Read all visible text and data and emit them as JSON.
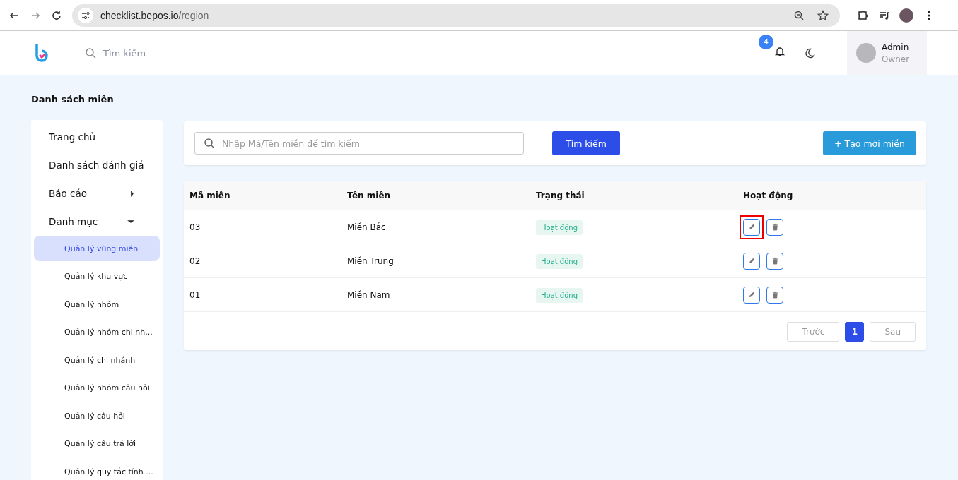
{
  "browser": {
    "url_host": "checklist.bepos.io",
    "url_path": "/region"
  },
  "header": {
    "search_placeholder": "Tìm kiếm",
    "notification_count": "4",
    "user": {
      "name": "Admin",
      "role": "Owner"
    }
  },
  "page_title": "Danh sách miền",
  "sidebar": {
    "items": [
      {
        "label": "Trang chủ",
        "kind": "link"
      },
      {
        "label": "Danh sách đánh giá",
        "kind": "link"
      },
      {
        "label": "Báo cáo",
        "kind": "group",
        "expanded": false
      },
      {
        "label": "Danh mục",
        "kind": "group",
        "expanded": true,
        "children": [
          {
            "label": "Quản lý vùng miền",
            "selected": true
          },
          {
            "label": "Quản lý khu vực",
            "selected": false
          },
          {
            "label": "Quản lý nhóm",
            "selected": false
          },
          {
            "label": "Quản lý nhóm chi nh...",
            "selected": false
          },
          {
            "label": "Quản lý chi nhánh",
            "selected": false
          },
          {
            "label": "Quản lý nhóm câu hỏi",
            "selected": false
          },
          {
            "label": "Quản lý câu hỏi",
            "selected": false
          },
          {
            "label": "Quản lý câu trả lời",
            "selected": false
          },
          {
            "label": "Quản lý quy tắc tính ...",
            "selected": false
          }
        ]
      }
    ]
  },
  "toolbar": {
    "search_placeholder": "Nhập Mã/Tên miền để tìm kiếm",
    "search_button": "Tìm kiếm",
    "create_button": "+ Tạo mới miền"
  },
  "table": {
    "columns": [
      "Mã miền",
      "Tên miền",
      "Trạng thái",
      "Hoạt động"
    ],
    "rows": [
      {
        "code": "03",
        "name": "Miền Bắc",
        "status": "Hoạt động",
        "edit_highlighted": true
      },
      {
        "code": "02",
        "name": "Miền Trung",
        "status": "Hoạt động",
        "edit_highlighted": false
      },
      {
        "code": "01",
        "name": "Miền Nam",
        "status": "Hoạt động",
        "edit_highlighted": false
      }
    ]
  },
  "pagination": {
    "prev": "Trước",
    "next": "Sau",
    "pages": [
      {
        "label": "1",
        "selected": true
      }
    ]
  }
}
